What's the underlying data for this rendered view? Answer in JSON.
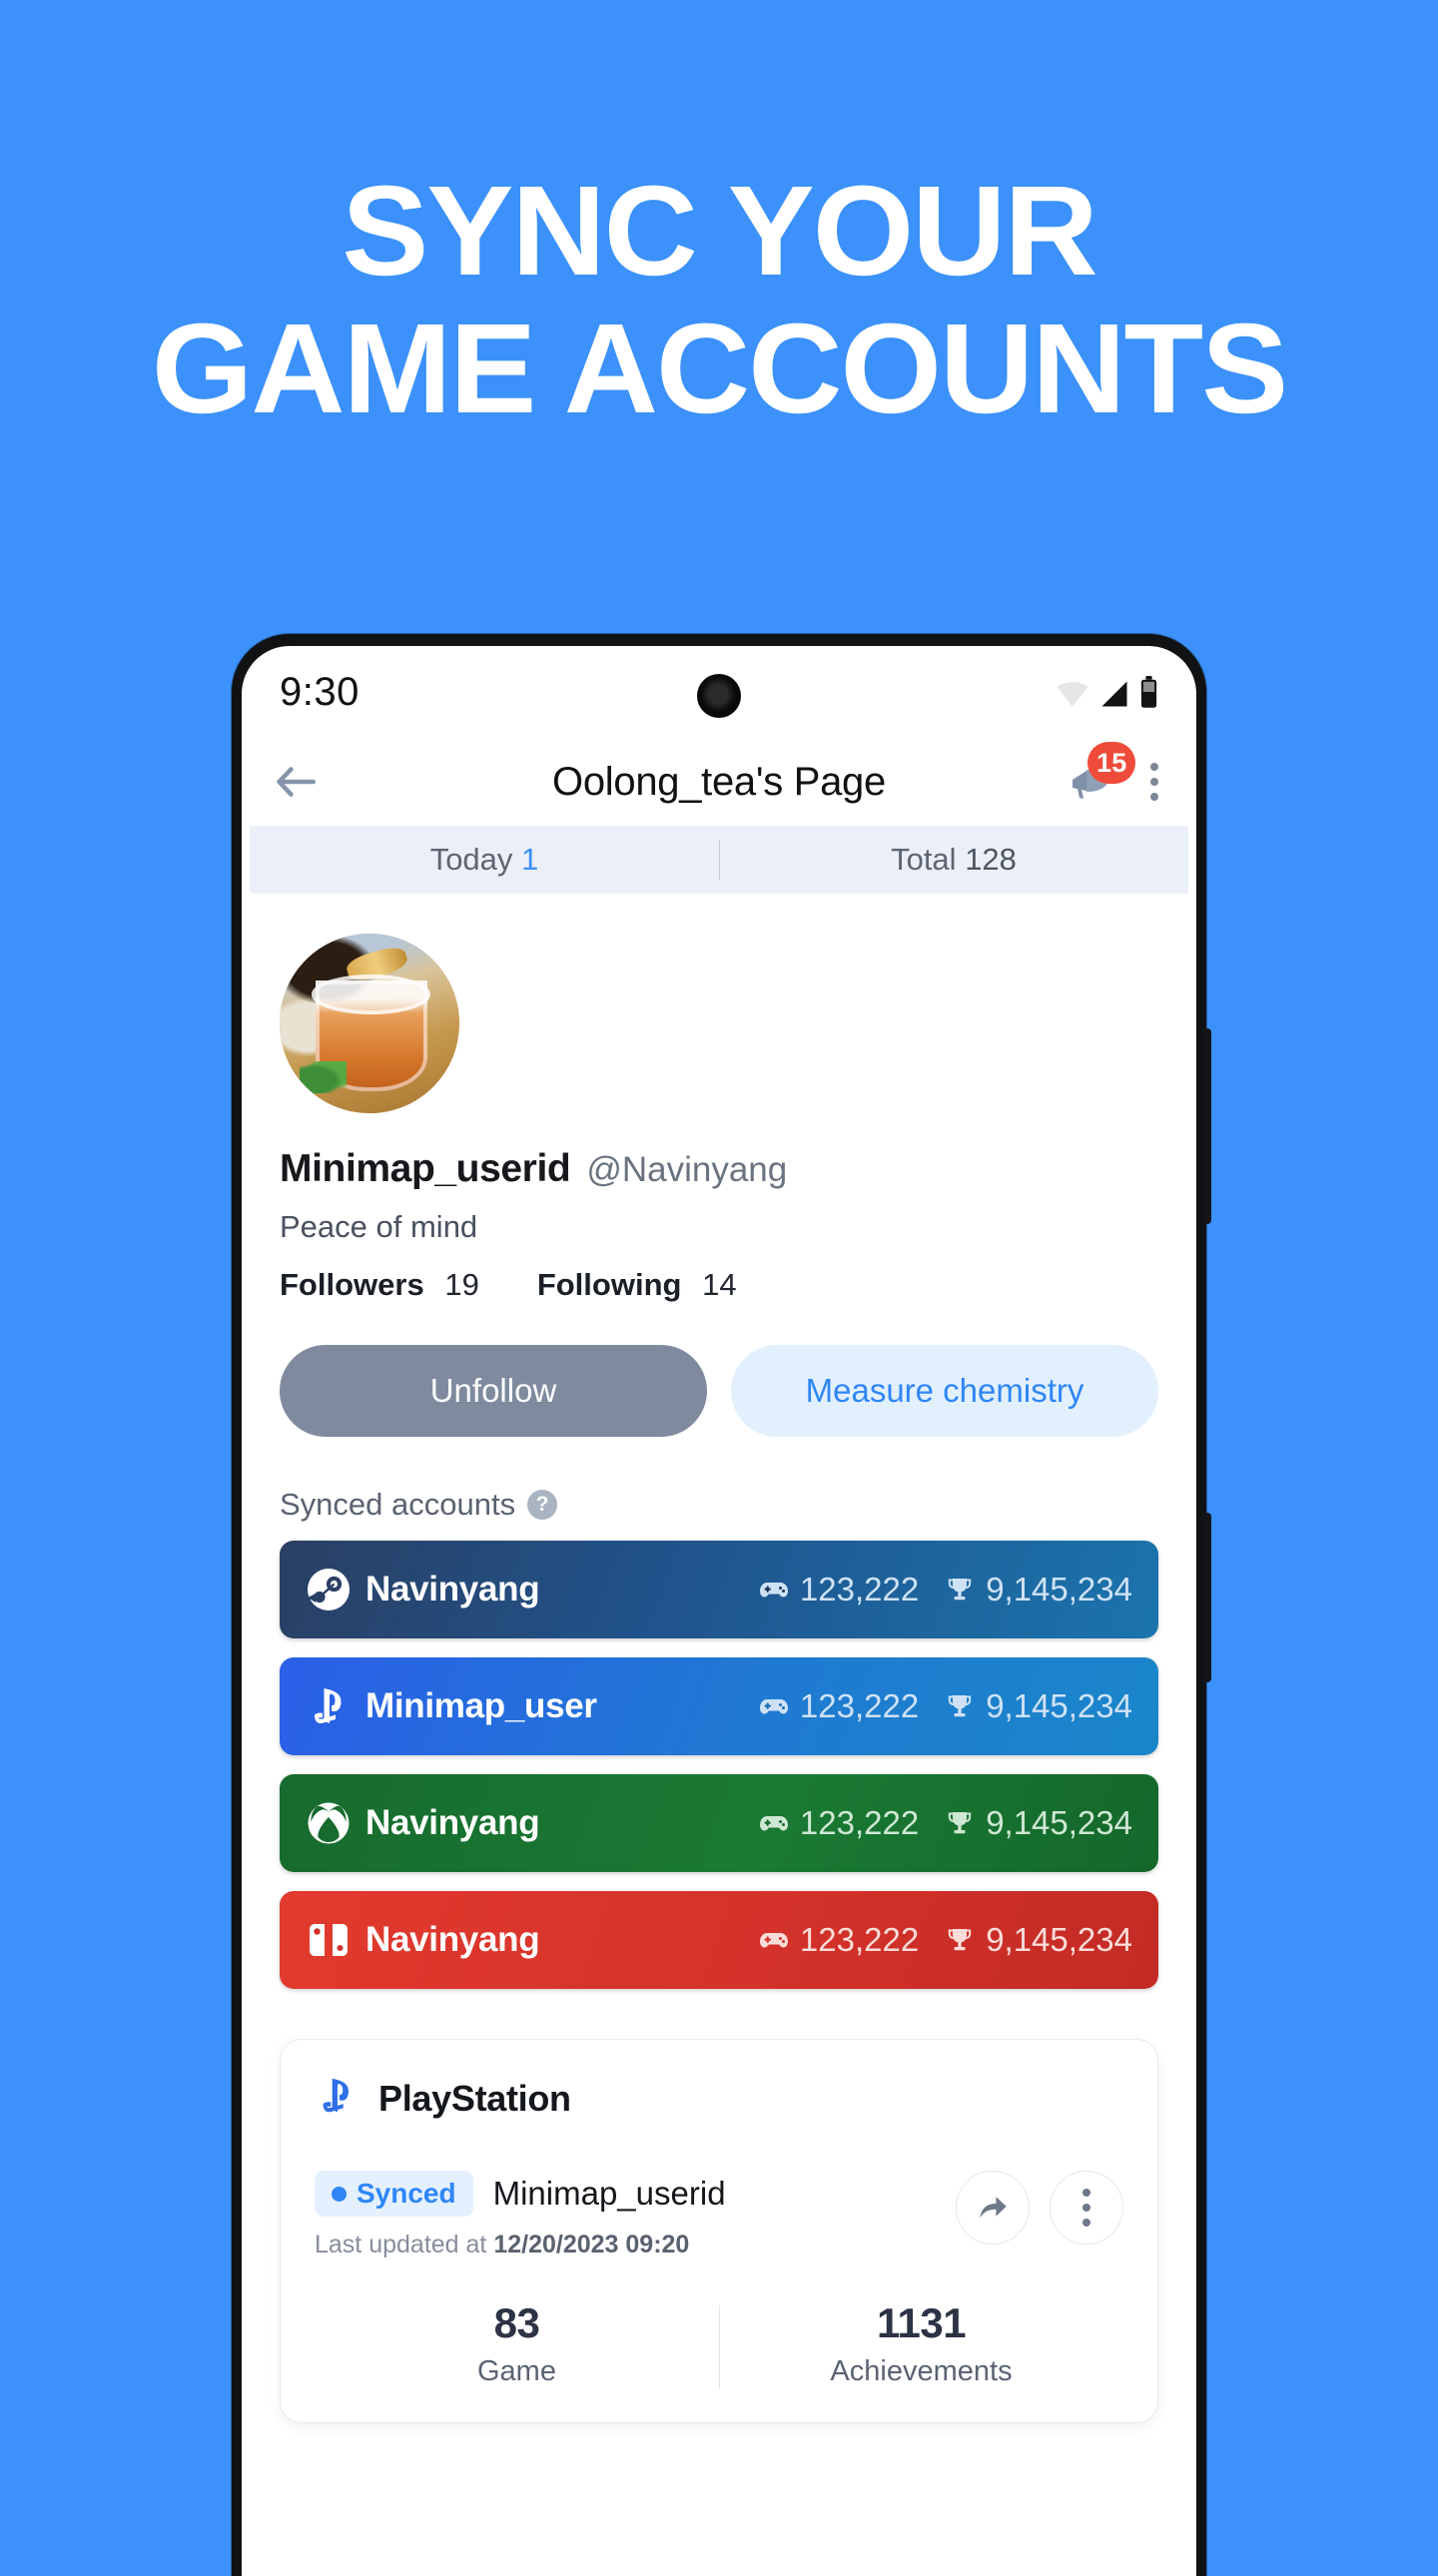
{
  "hero": {
    "line1": "SYNC YOUR",
    "line2": "GAME ACCOUNTS"
  },
  "theme": {
    "background": "#3C91FA",
    "accent_blue": "#2F86F6",
    "badge_red": "#EE4B3A"
  },
  "statusbar": {
    "time": "9:30",
    "wifi_icon": "wifi-icon",
    "signal_icon": "cellular-signal-icon",
    "battery_icon": "battery-icon"
  },
  "navbar": {
    "back_icon": "back-arrow-icon",
    "title": "Oolong_tea's Page",
    "megaphone_icon": "megaphone-icon",
    "notification_count": "15",
    "overflow_icon": "kebab-menu-icon"
  },
  "stats_strip": [
    {
      "label": "Today",
      "value": "1",
      "accent": true
    },
    {
      "label": "Total",
      "value": "128",
      "accent": false
    }
  ],
  "profile": {
    "avatar_name": "avatar-tea-photo",
    "display_name": "Minimap_userid",
    "handle": "@Navinyang",
    "bio": "Peace of mind",
    "followers_label": "Followers",
    "followers_count": "19",
    "following_label": "Following",
    "following_count": "14",
    "unfollow_label": "Unfollow",
    "chemistry_label": "Measure chemistry"
  },
  "synced": {
    "section_label": "Synced accounts",
    "help_icon": "help-circle-icon",
    "help_glyph": "?",
    "accounts": [
      {
        "platform": "steam",
        "logo_icon": "steam-logo-icon",
        "username": "Navinyang",
        "games_icon": "gamepad-icon",
        "games": "123,222",
        "trophies_icon": "trophy-icon",
        "trophies": "9,145,234"
      },
      {
        "platform": "psn",
        "logo_icon": "playstation-logo-icon",
        "username": "Minimap_user",
        "games_icon": "gamepad-icon",
        "games": "123,222",
        "trophies_icon": "trophy-icon",
        "trophies": "9,145,234"
      },
      {
        "platform": "xbox",
        "logo_icon": "xbox-logo-icon",
        "username": "Navinyang",
        "games_icon": "gamepad-icon",
        "games": "123,222",
        "trophies_icon": "trophy-icon",
        "trophies": "9,145,234"
      },
      {
        "platform": "nsw",
        "logo_icon": "nintendo-switch-logo-icon",
        "username": "Navinyang",
        "games_icon": "gamepad-icon",
        "games": "123,222",
        "trophies_icon": "trophy-icon",
        "trophies": "9,145,234"
      }
    ]
  },
  "ps_card": {
    "logo_icon": "playstation-logo-icon",
    "title": "PlayStation",
    "status_label": "Synced",
    "username": "Minimap_userid",
    "updated_prefix": "Last updated at",
    "updated_value": "12/20/2023 09:20",
    "share_icon": "share-arrow-icon",
    "overflow_icon": "kebab-menu-icon",
    "stats": [
      {
        "num": "83",
        "cap": "Game"
      },
      {
        "num": "1131",
        "cap": "Achievements"
      }
    ]
  }
}
